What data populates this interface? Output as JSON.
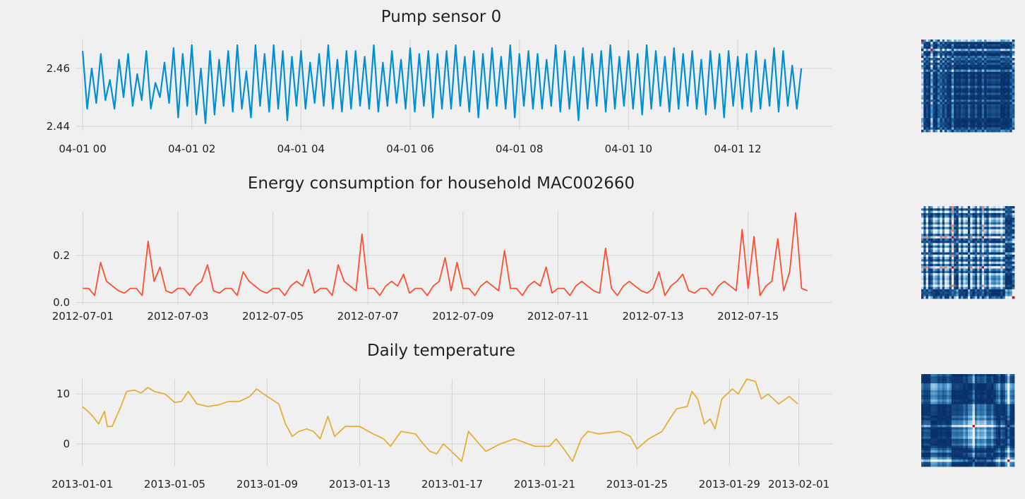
{
  "chart_data": [
    {
      "type": "line",
      "title": "Pump sensor 0",
      "color": "#008fd5",
      "x_start": "2000-04-01T00:00",
      "x_step_minutes": 5,
      "xlim_hours": [
        -0.13,
        13.72
      ],
      "ylim": [
        2.44,
        2.4702
      ],
      "yticks": [
        2.44,
        2.46
      ],
      "ytick_labels": [
        "2.44",
        "2.46"
      ],
      "xticks_hours": [
        0,
        2,
        4,
        6,
        8,
        10,
        12
      ],
      "xtick_labels": [
        "04-01 00",
        "04-01 02",
        "04-01 04",
        "04-01 06",
        "04-01 08",
        "04-01 10",
        "04-01 12"
      ],
      "grid": true,
      "values": [
        2.466,
        2.446,
        2.46,
        2.448,
        2.465,
        2.449,
        2.456,
        2.446,
        2.463,
        2.45,
        2.465,
        2.447,
        2.458,
        2.449,
        2.466,
        2.446,
        2.455,
        2.45,
        2.462,
        2.448,
        2.467,
        2.443,
        2.465,
        2.447,
        2.468,
        2.444,
        2.46,
        2.441,
        2.466,
        2.444,
        2.463,
        2.447,
        2.466,
        2.445,
        2.468,
        2.446,
        2.459,
        2.443,
        2.468,
        2.447,
        2.465,
        2.445,
        2.468,
        2.446,
        2.466,
        2.442,
        2.464,
        2.447,
        2.466,
        2.446,
        2.462,
        2.448,
        2.465,
        2.447,
        2.468,
        2.446,
        2.463,
        2.445,
        2.466,
        2.446,
        2.466,
        2.447,
        2.464,
        2.446,
        2.468,
        2.445,
        2.462,
        2.447,
        2.466,
        2.448,
        2.463,
        2.446,
        2.467,
        2.445,
        2.465,
        2.447,
        2.466,
        2.443,
        2.465,
        2.446,
        2.466,
        2.446,
        2.468,
        2.447,
        2.464,
        2.445,
        2.466,
        2.443,
        2.465,
        2.446,
        2.467,
        2.447,
        2.464,
        2.446,
        2.468,
        2.443,
        2.465,
        2.447,
        2.466,
        2.446,
        2.465,
        2.446,
        2.463,
        2.447,
        2.468,
        2.445,
        2.466,
        2.446,
        2.464,
        2.442,
        2.467,
        2.446,
        2.465,
        2.447,
        2.466,
        2.445,
        2.468,
        2.446,
        2.464,
        2.447,
        2.466,
        2.446,
        2.465,
        2.444,
        2.468,
        2.446,
        2.466,
        2.447,
        2.464,
        2.445,
        2.467,
        2.446,
        2.465,
        2.447,
        2.466,
        2.446,
        2.463,
        2.444,
        2.466,
        2.446,
        2.465,
        2.443,
        2.466,
        2.447,
        2.464,
        2.446,
        2.465,
        2.445,
        2.466,
        2.446,
        2.463,
        2.447,
        2.467,
        2.445,
        2.466,
        2.447,
        2.461,
        2.446,
        2.46
      ]
    },
    {
      "type": "line",
      "title": "Energy consumption for household MAC002660",
      "color": "#fc4f30",
      "x_start": "2012-07-01T00:00",
      "x_step_minutes": 180,
      "xlim_days": [
        "2012-06-30T20:20",
        "2012-07-16T18:10"
      ],
      "ylim": [
        -0.01,
        0.385
      ],
      "yticks": [
        0.0,
        0.2
      ],
      "ytick_labels": [
        "0.0",
        "0.2"
      ],
      "xticks": [
        "2012-07-01",
        "2012-07-03",
        "2012-07-05",
        "2012-07-07",
        "2012-07-09",
        "2012-07-11",
        "2012-07-13",
        "2012-07-15"
      ],
      "xtick_labels": [
        "2012-07-01",
        "2012-07-03",
        "2012-07-05",
        "2012-07-07",
        "2012-07-09",
        "2012-07-11",
        "2012-07-13",
        "2012-07-15"
      ],
      "grid": true,
      "values": [
        0.06,
        0.06,
        0.03,
        0.17,
        0.09,
        0.07,
        0.05,
        0.04,
        0.06,
        0.06,
        0.03,
        0.26,
        0.09,
        0.15,
        0.05,
        0.04,
        0.06,
        0.06,
        0.03,
        0.07,
        0.09,
        0.16,
        0.05,
        0.04,
        0.06,
        0.06,
        0.03,
        0.13,
        0.09,
        0.07,
        0.05,
        0.04,
        0.06,
        0.06,
        0.03,
        0.07,
        0.09,
        0.07,
        0.14,
        0.04,
        0.06,
        0.06,
        0.03,
        0.16,
        0.09,
        0.07,
        0.05,
        0.29,
        0.06,
        0.06,
        0.03,
        0.07,
        0.09,
        0.07,
        0.12,
        0.04,
        0.06,
        0.06,
        0.03,
        0.07,
        0.09,
        0.19,
        0.05,
        0.17,
        0.06,
        0.06,
        0.03,
        0.07,
        0.09,
        0.07,
        0.05,
        0.22,
        0.06,
        0.06,
        0.03,
        0.07,
        0.09,
        0.07,
        0.15,
        0.04,
        0.06,
        0.06,
        0.03,
        0.07,
        0.09,
        0.07,
        0.05,
        0.04,
        0.23,
        0.06,
        0.03,
        0.07,
        0.09,
        0.07,
        0.05,
        0.04,
        0.06,
        0.13,
        0.03,
        0.07,
        0.09,
        0.12,
        0.05,
        0.04,
        0.06,
        0.06,
        0.03,
        0.07,
        0.09,
        0.07,
        0.05,
        0.31,
        0.06,
        0.28,
        0.03,
        0.07,
        0.09,
        0.27,
        0.05,
        0.13,
        0.38,
        0.06,
        0.05
      ]
    },
    {
      "type": "line",
      "title": "Daily temperature",
      "color": "#e5ae38",
      "xlim_days": [
        "2012-12-31T17:00",
        "2013-02-02T10:00"
      ],
      "ylim": [
        -4.4,
        13.0
      ],
      "yticks": [
        0,
        10
      ],
      "ytick_labels": [
        "0",
        "10"
      ],
      "xticks": [
        "2013-01-01",
        "2013-01-05",
        "2013-01-09",
        "2013-01-13",
        "2013-01-17",
        "2013-01-21",
        "2013-01-25",
        "2013-01-29",
        "2013-02-01"
      ],
      "xtick_labels": [
        "2013-01-01",
        "2013-01-05",
        "2013-01-09",
        "2013-01-13",
        "2013-01-17",
        "2013-01-21",
        "2013-01-25",
        "2013-01-29",
        "2013-02-01"
      ],
      "grid": true,
      "points": [
        [
          "2013-01-01T00:00",
          7.5
        ],
        [
          "2013-01-01T06:00",
          6.5
        ],
        [
          "2013-01-01T11:00",
          5.5
        ],
        [
          "2013-01-01T17:00",
          4
        ],
        [
          "2013-01-01T23:00",
          6.5
        ],
        [
          "2013-01-02T02:00",
          3.5
        ],
        [
          "2013-01-02T07:00",
          3.5
        ],
        [
          "2013-01-02T15:00",
          7
        ],
        [
          "2013-01-02T22:00",
          10.5
        ],
        [
          "2013-01-03T06:00",
          10.8
        ],
        [
          "2013-01-03T13:00",
          10.2
        ],
        [
          "2013-01-03T20:00",
          11.3
        ],
        [
          "2013-01-04T03:00",
          10.5
        ],
        [
          "2013-01-04T14:00",
          10
        ],
        [
          "2013-01-05T00:00",
          8.3
        ],
        [
          "2013-01-05T07:00",
          8.5
        ],
        [
          "2013-01-05T14:00",
          10.5
        ],
        [
          "2013-01-05T23:00",
          8
        ],
        [
          "2013-01-06T10:00",
          7.5
        ],
        [
          "2013-01-06T21:00",
          7.8
        ],
        [
          "2013-01-07T08:00",
          8.5
        ],
        [
          "2013-01-07T19:00",
          8.5
        ],
        [
          "2013-01-08T06:00",
          9.5
        ],
        [
          "2013-01-08T13:00",
          11
        ],
        [
          "2013-01-09T00:00",
          9.5
        ],
        [
          "2013-01-09T12:00",
          8
        ],
        [
          "2013-01-09T19:00",
          4
        ],
        [
          "2013-01-10T02:00",
          1.5
        ],
        [
          "2013-01-10T09:00",
          2.5
        ],
        [
          "2013-01-10T17:00",
          3
        ],
        [
          "2013-01-11T00:00",
          2.5
        ],
        [
          "2013-01-11T07:00",
          1
        ],
        [
          "2013-01-11T15:00",
          5.5
        ],
        [
          "2013-01-11T22:00",
          1.5
        ],
        [
          "2013-01-12T09:00",
          3.5
        ],
        [
          "2013-01-13T00:00",
          3.5
        ],
        [
          "2013-01-13T14:00",
          2
        ],
        [
          "2013-01-14T01:00",
          1
        ],
        [
          "2013-01-14T08:00",
          -0.5
        ],
        [
          "2013-01-14T19:00",
          2.5
        ],
        [
          "2013-01-15T10:00",
          2
        ],
        [
          "2013-01-15T18:00",
          0
        ],
        [
          "2013-01-16T01:00",
          -1.5
        ],
        [
          "2013-01-16T08:00",
          -2
        ],
        [
          "2013-01-16T15:00",
          0
        ],
        [
          "2013-01-17T02:00",
          -2
        ],
        [
          "2013-01-17T10:00",
          -3.5
        ],
        [
          "2013-01-17T17:00",
          2.5
        ],
        [
          "2013-01-18T04:00",
          0
        ],
        [
          "2013-01-18T11:00",
          -1.5
        ],
        [
          "2013-01-19T02:00",
          0
        ],
        [
          "2013-01-19T17:00",
          1
        ],
        [
          "2013-01-20T14:00",
          -0.5
        ],
        [
          "2013-01-21T05:00",
          -0.5
        ],
        [
          "2013-01-21T12:00",
          1
        ],
        [
          "2013-01-21T20:00",
          -1
        ],
        [
          "2013-01-22T05:00",
          -3.5
        ],
        [
          "2013-01-22T14:00",
          1
        ],
        [
          "2013-01-22T21:00",
          2.5
        ],
        [
          "2013-01-23T08:00",
          2
        ],
        [
          "2013-01-24T06:00",
          2.5
        ],
        [
          "2013-01-24T17:00",
          1.5
        ],
        [
          "2013-01-25T00:00",
          -1
        ],
        [
          "2013-01-25T12:00",
          1
        ],
        [
          "2013-01-26T02:00",
          2.5
        ],
        [
          "2013-01-26T10:00",
          5
        ],
        [
          "2013-01-26T17:00",
          7
        ],
        [
          "2013-01-27T04:00",
          7.5
        ],
        [
          "2013-01-27T09:00",
          10.5
        ],
        [
          "2013-01-27T15:00",
          9
        ],
        [
          "2013-01-27T22:00",
          4
        ],
        [
          "2013-01-28T04:00",
          5
        ],
        [
          "2013-01-28T09:00",
          3
        ],
        [
          "2013-01-28T16:00",
          9
        ],
        [
          "2013-01-29T03:00",
          11
        ],
        [
          "2013-01-29T09:00",
          10
        ],
        [
          "2013-01-29T18:00",
          13
        ],
        [
          "2013-01-30T03:00",
          12.5
        ],
        [
          "2013-01-30T09:00",
          9
        ],
        [
          "2013-01-30T16:00",
          10
        ],
        [
          "2013-01-31T03:00",
          8
        ],
        [
          "2013-01-31T14:00",
          9.5
        ],
        [
          "2013-01-31T23:00",
          8
        ]
      ]
    },
    {
      "type": "heatmap",
      "note_source": "recurrence image of each series, shown to the right of each line chart",
      "colormap": "RdBu_r",
      "color_low": "#08306b",
      "color_high": "#b2182b"
    }
  ]
}
